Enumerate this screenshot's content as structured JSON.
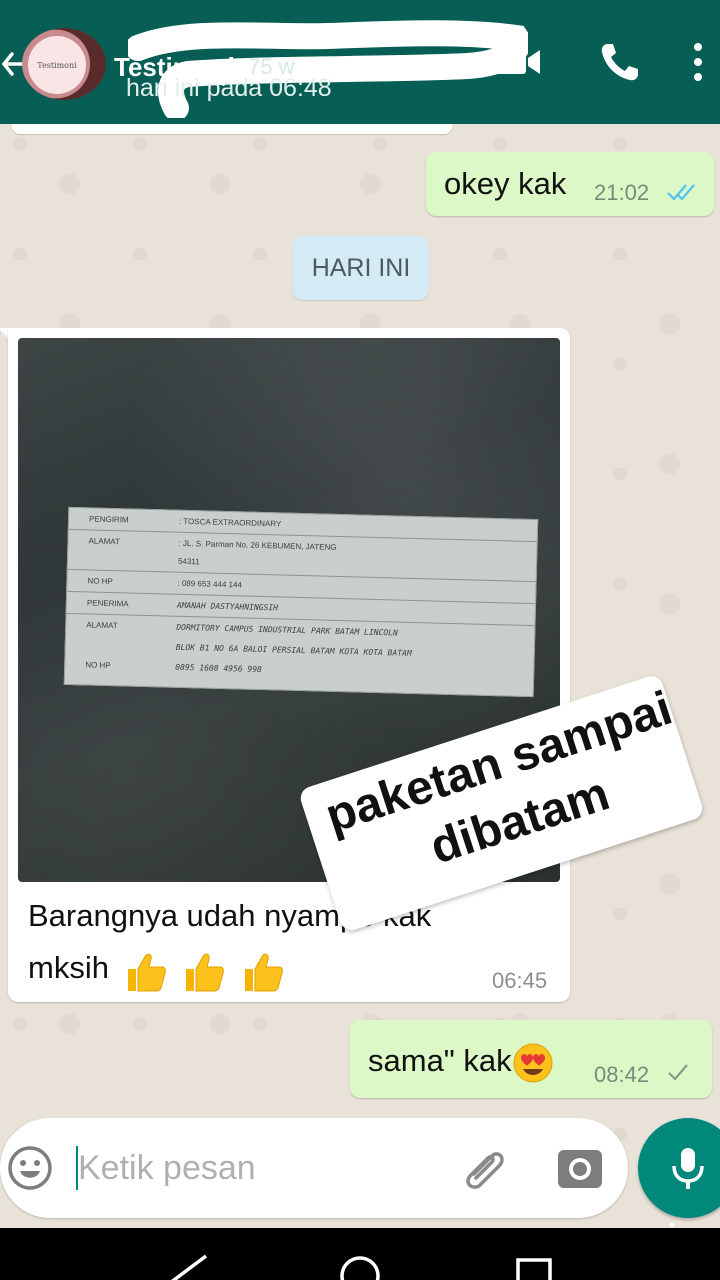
{
  "header": {
    "avatar_text": "Testimoni",
    "contact_name": "Testimoni",
    "time_ago": "75 w",
    "last_seen": "hari ini pada 06:48"
  },
  "date_chip": "HARI INI",
  "messages": [
    {
      "direction": "outgoing",
      "text": "okey kak",
      "time": "21:02",
      "status": "read"
    },
    {
      "direction": "incoming",
      "type": "image",
      "caption": "Barangnya udah nyampe kak mksih",
      "caption_emoji": "thumbs-up x3",
      "time": "06:45",
      "image": {
        "label_rows": [
          {
            "key": "PENGIRIM",
            "value": ": TOSCA EXTRAORDINARY"
          },
          {
            "key": "ALAMAT",
            "value": ": JL. S. Parman No. 26 KEBUMEN, JATENG"
          },
          {
            "key": "",
            "value": "54311"
          },
          {
            "key": "NO HP",
            "value": ": 089 653 444 144"
          },
          {
            "key": "PENERIMA",
            "value": "AMANAH DASTYAHNINGSIH"
          },
          {
            "key": "ALAMAT",
            "value": "DORMITORY CAMPUS INDUSTRIAL PARK BATAM LINCOLN"
          },
          {
            "key": "",
            "value": "BLOK B1 NO 6A BALOI PERSIAL BATAM KOTA KOTA BATAM"
          },
          {
            "key": "NO HP",
            "value": "0895 1608 4956 998"
          }
        ],
        "sticker_line1": "paketan sampai",
        "sticker_line2": "dibatam"
      }
    },
    {
      "direction": "outgoing",
      "text": "sama\" kak",
      "text_emoji": "heart-eyes",
      "time": "08:42",
      "status": "sent"
    }
  ],
  "composer": {
    "placeholder": "Ketik pesan"
  },
  "colors": {
    "header": "#075e54",
    "outgoing_bubble": "#dcf8c6",
    "incoming_bubble": "#ffffff",
    "accent": "#00897b",
    "read_ticks": "#4fc3f7"
  }
}
